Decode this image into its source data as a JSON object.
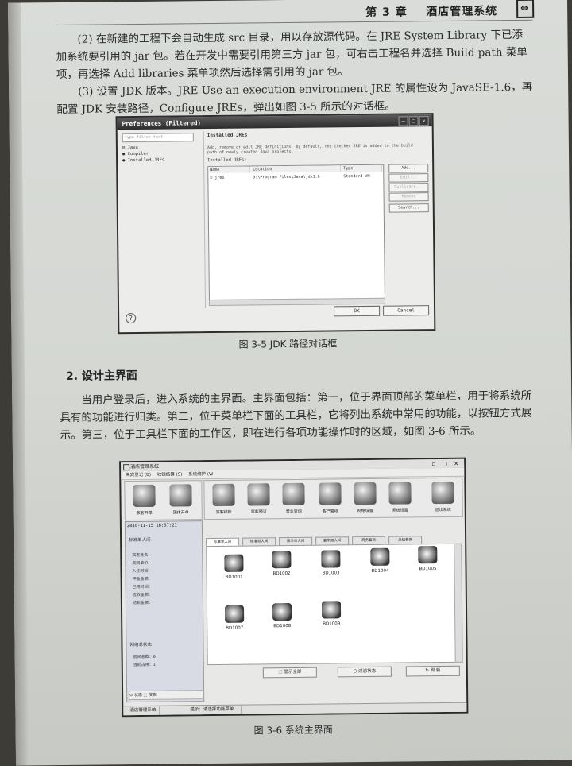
{
  "header": {
    "chapter": "第 3 章",
    "title": "酒店管理系统"
  },
  "paragraphs": {
    "p1": "(2) 在新建的工程下会自动生成 src 目录，用以存放源代码。在 JRE System Library 下已添加系统要引用的 jar 包。若在开发中需要引用第三方 jar 包，可右击工程名并选择 Build path 菜单项，再选择 Add libraries 菜单项然后选择需引用的 jar 包。",
    "p2": "(3) 设置 JDK 版本。JRE Use an execution environment JRE 的属性设为 JavaSE-1.6，再配置 JDK 安装路径，Configure JREs，弹出如图 3-5 所示的对话框。",
    "section": "2. 设计主界面",
    "p3": "当用户登录后，进入系统的主界面。主界面包括：第一，位于界面顶部的菜单栏，用于将系统所具有的功能进行归类。第二，位于菜单栏下面的工具栏，它将列出系统中常用的功能，以按钮方式展示。第三，位于工具栏下面的工作区，即在进行各项功能操作时的区域，如图 3-6 所示。"
  },
  "figure1": {
    "caption": "图 3-5   JDK 路径对话框",
    "dialog": {
      "title": "Preferences (Filtered)",
      "filter_placeholder": "type filter text",
      "tree": [
        "⊟ Java",
        "   ● Compiler",
        "   ● Installed JREs"
      ],
      "heading": "Installed JREs",
      "description": "Add, remove or edit JRE definitions. By default, the checked JRE is added to the build path of newly created Java projects.",
      "list_label": "Installed JREs:",
      "columns": [
        "Name",
        "Location",
        "Type"
      ],
      "row": {
        "name": "jre6",
        "location": "D:\\Program Files\\Java\\jdk1.6",
        "type": "Standard VM"
      },
      "buttons": [
        "Add...",
        "Edit...",
        "Duplicate...",
        "Remove",
        "Search..."
      ],
      "ok": "OK",
      "cancel": "Cancel",
      "help": "?"
    }
  },
  "figure2": {
    "caption": "图 3-6   系统主界面",
    "app": {
      "title": "酒店管理系统",
      "window_controls": "▫ □ ✕",
      "menu": [
        "来宾登记 (B)",
        "收银结算 (S)",
        "系统维护 (W)"
      ],
      "toolbar_left": [
        "散客开单",
        "团体开单"
      ],
      "toolbar_right": [
        "宾客结账",
        "宾客预订",
        "营业查询",
        "客户管理",
        "网络设置",
        "系统设置",
        "退出系统"
      ],
      "time": "2010-11-15 16:57:21",
      "sidebar_title": "标准单人间",
      "sidebar_rows": [
        "宾客姓名：",
        "房间单价：",
        "入住时间：",
        "押金金额：",
        "已用时间：",
        "应收金额：",
        "结账金额："
      ],
      "status_title": "网络总状态",
      "status_rows": [
        "房间总数：6",
        "当前占用：1"
      ],
      "side_footer": "⊙ 状态   ⬚ 搜索",
      "tabs": [
        "标准单人间",
        "标准双人间",
        "豪华单人间",
        "豪华双人间",
        "商务套房",
        "总统套房"
      ],
      "rooms": [
        "BD1001",
        "BD1002",
        "BD1003",
        "BD1004",
        "BD1005",
        "BD1007",
        "BD1008",
        "BD1009"
      ],
      "actions": [
        "显示全部",
        "过滤状态",
        "刷 新"
      ],
      "status_bar": [
        "酒店管理系统",
        "提示：请选择功能菜单..."
      ]
    }
  }
}
